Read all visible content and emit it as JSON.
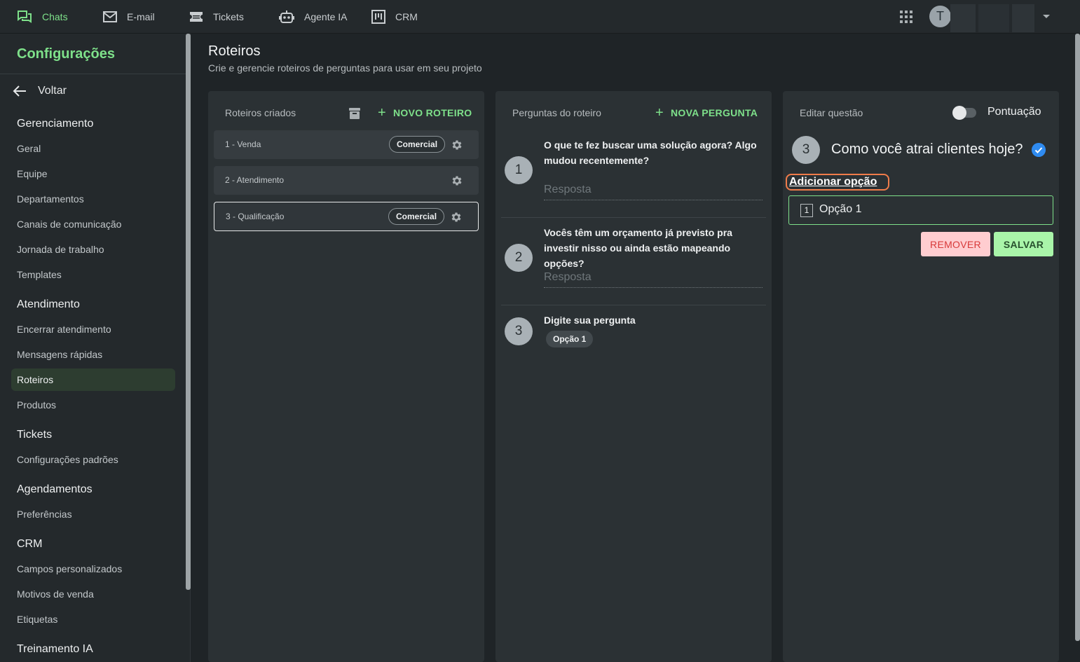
{
  "topnav": {
    "items": [
      {
        "label": "Chats",
        "icon": "chat-icon",
        "active": true
      },
      {
        "label": "E-mail",
        "icon": "mail-icon"
      },
      {
        "label": "Tickets",
        "icon": "ticket-icon"
      },
      {
        "label": "Agente IA",
        "icon": "robot-icon"
      },
      {
        "label": "CRM",
        "icon": "kanban-icon"
      }
    ],
    "avatar_initial": "T"
  },
  "sidebar": {
    "title": "Configurações",
    "back_label": "Voltar",
    "sections": [
      {
        "title": "Gerenciamento",
        "items": [
          "Geral",
          "Equipe",
          "Departamentos",
          "Canais de comunicação",
          "Jornada de trabalho",
          "Templates"
        ]
      },
      {
        "title": "Atendimento",
        "items": [
          "Encerrar atendimento",
          "Mensagens rápidas",
          "Roteiros",
          "Produtos"
        ]
      },
      {
        "title": "Tickets",
        "items": [
          "Configurações padrões"
        ]
      },
      {
        "title": "Agendamentos",
        "items": [
          "Preferências"
        ]
      },
      {
        "title": "CRM",
        "items": [
          "Campos personalizados",
          "Motivos de venda",
          "Etiquetas"
        ]
      },
      {
        "title": "Treinamento IA",
        "items": []
      }
    ],
    "active_item": "Roteiros"
  },
  "page": {
    "title": "Roteiros",
    "subtitle": "Crie e gerencie roteiros de perguntas para usar em seu projeto"
  },
  "roteiros_panel": {
    "header": "Roteiros criados",
    "new_button": "NOVO ROTEIRO",
    "items": [
      {
        "label": "1 - Venda",
        "tag": "Comercial"
      },
      {
        "label": "2 - Atendimento",
        "tag": ""
      },
      {
        "label": "3 - Qualificação",
        "tag": "Comercial",
        "selected": true
      }
    ]
  },
  "perguntas_panel": {
    "header": "Perguntas do roteiro",
    "new_button": "NOVA PERGUNTA",
    "questions": [
      {
        "number": "1",
        "text": "O que te fez buscar uma solução agora? Algo mudou recentemente?",
        "answer_placeholder": "Resposta"
      },
      {
        "number": "2",
        "text": "Vocês têm um orçamento já previsto pra investir nisso ou ainda estão mapeando opções?",
        "answer_placeholder": "Resposta"
      },
      {
        "number": "3",
        "text": "Digite sua pergunta",
        "option_chip": "Opção 1"
      }
    ]
  },
  "editar_panel": {
    "header": "Editar questão",
    "toggle_label": "Pontuação",
    "toggle_on": false,
    "question_number": "3",
    "question_text": "Como você atrai clientes hoje?",
    "add_option_label": "Adicionar opção",
    "option": {
      "number": "1",
      "text": "Opção 1"
    },
    "remove_button": "REMOVER",
    "save_button": "SALVAR"
  },
  "colors": {
    "accent": "#7ee08a",
    "background": "#1f2427",
    "panel": "#2b3134",
    "remove_bg": "#ffcdd0",
    "save_bg": "#a9f5a9",
    "highlight": "#f07c4a",
    "check": "#2f8bf0"
  }
}
